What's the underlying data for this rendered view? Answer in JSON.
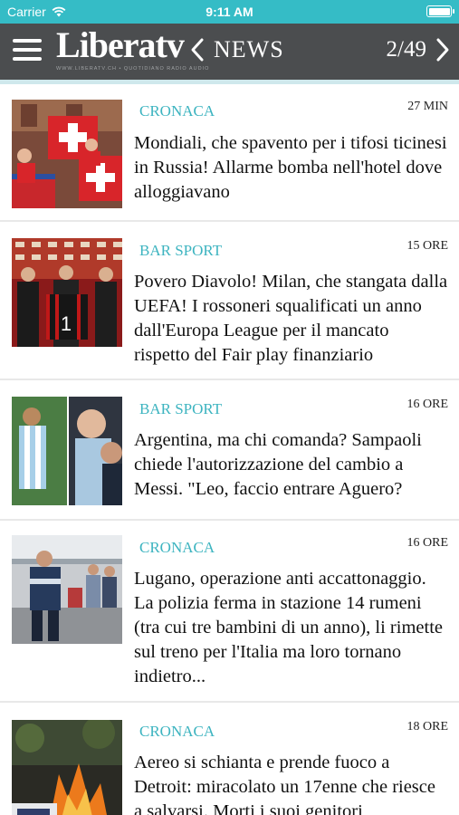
{
  "status_bar": {
    "carrier": "Carrier",
    "time": "9:11 AM"
  },
  "header": {
    "logo": "Liberatv",
    "logo_tagline": "WWW.LIBERATV.CH • QUOTIDIANO RADIO AUDIO",
    "section": "NEWS",
    "pager": "2/49"
  },
  "colors": {
    "status_bar": "#35bcc6",
    "navbar": "#4b4d4f",
    "category": "#3db4c0"
  },
  "articles": [
    {
      "category": "CRONACA",
      "time": "27 MIN",
      "headline_lines": [
        "Mondiali, che spavento per i tifosi ticinesi",
        "in Russia! Allarme bomba nell'hotel dove",
        "alloggiavano"
      ]
    },
    {
      "category": "BAR SPORT",
      "time": "15 ORE",
      "headline_lines": [
        "Povero Diavolo! Milan, che stangata dalla",
        "UEFA! I rossoneri squalificati un anno",
        "dall'Europa League per il mancato",
        "rispetto del Fair play finanziario"
      ]
    },
    {
      "category": "BAR SPORT",
      "time": "16 ORE",
      "headline_lines": [
        "Argentina, ma chi comanda? Sampaoli",
        "chiede l'autorizzazione del cambio a",
        "Messi. \"Leo, faccio entrare Aguero?"
      ]
    },
    {
      "category": "CRONACA",
      "time": "16 ORE",
      "headline_lines": [
        "Lugano, operazione anti accattonaggio.",
        "La polizia ferma in stazione 14 rumeni",
        "(tra cui tre bambini di un anno), li rimette",
        "sul treno per l'Italia ma loro tornano",
        "indietro..."
      ]
    },
    {
      "category": "CRONACA",
      "time": "18 ORE",
      "headline_lines": [
        "Aereo si schianta e prende fuoco a",
        "Detroit: miracolato un 17enne che riesce",
        "a salvarsi. Morti i suoi genitori"
      ]
    }
  ]
}
